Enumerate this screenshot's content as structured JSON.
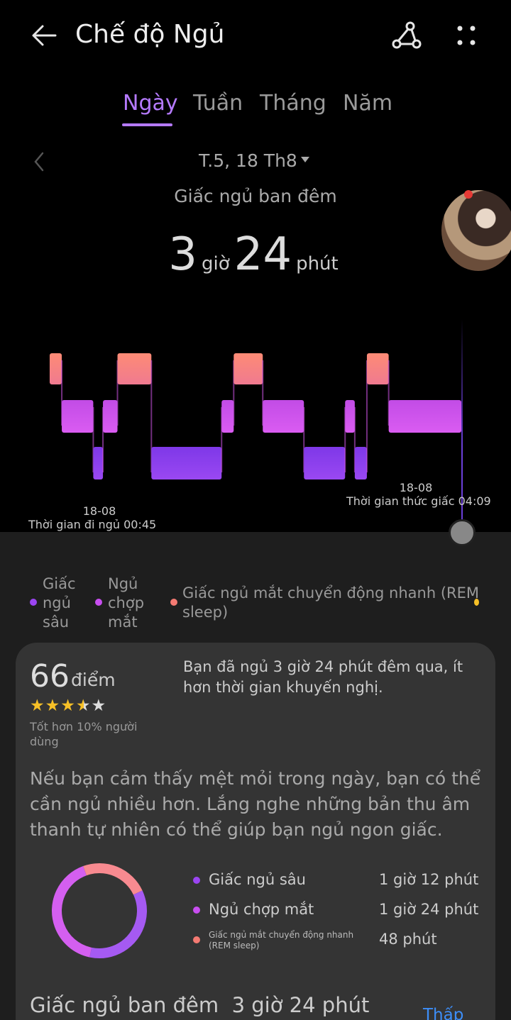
{
  "header": {
    "title": "Chế độ Ngủ"
  },
  "tabs": [
    {
      "label": "Ngày",
      "active": true
    },
    {
      "label": "Tuần",
      "active": false
    },
    {
      "label": "Tháng",
      "active": false
    },
    {
      "label": "Năm",
      "active": false
    }
  ],
  "date_selector": {
    "date": "T.5, 18 Th8"
  },
  "summary": {
    "subtitle": "Giấc ngủ ban đêm",
    "hours": "3",
    "hours_unit": "giờ",
    "minutes": "24",
    "minutes_unit": "phút"
  },
  "sleep_chart": {
    "stages": [
      "rem",
      "light",
      "deep"
    ],
    "segments": [
      {
        "stage": "rem",
        "start": 0.0,
        "end": 0.05
      },
      {
        "stage": "light",
        "start": 0.05,
        "end": 0.18
      },
      {
        "stage": "deep",
        "start": 0.18,
        "end": 0.22
      },
      {
        "stage": "light",
        "start": 0.22,
        "end": 0.28
      },
      {
        "stage": "rem",
        "start": 0.28,
        "end": 0.42
      },
      {
        "stage": "deep",
        "start": 0.42,
        "end": 0.71
      },
      {
        "stage": "light",
        "start": 0.71,
        "end": 0.76
      },
      {
        "stage": "rem",
        "start": 0.76,
        "end": 0.88
      },
      {
        "stage": "light",
        "start": 0.88,
        "end": 1.05
      },
      {
        "stage": "deep",
        "start": 1.05,
        "end": 1.22
      },
      {
        "stage": "light",
        "start": 1.22,
        "end": 1.26
      },
      {
        "stage": "deep",
        "start": 1.26,
        "end": 1.31
      },
      {
        "stage": "rem",
        "start": 1.31,
        "end": 1.4
      },
      {
        "stage": "light",
        "start": 1.4,
        "end": 1.7
      }
    ],
    "total_span": 1.7,
    "sleep_time_date": "18-08",
    "sleep_time_label": "Thời gian đi ngủ 00:45",
    "wake_time_date": "18-08",
    "wake_time_label": "Thời gian thức giấc 04:09",
    "colors": {
      "rem": "#f98a7c",
      "light": "#c84ef0",
      "deep": "#8c3cf0"
    }
  },
  "legend": [
    {
      "label": "Giấc ngủ sâu",
      "color": "#9b45f2"
    },
    {
      "label": "Ngủ chợp mắt",
      "color": "#c84ef0"
    },
    {
      "label": "Giấc ngủ mắt chuyển động nhanh (REM sleep)",
      "color": "#f47a72"
    }
  ],
  "score_card": {
    "score": "66",
    "score_unit": "điểm",
    "stars_full": 3,
    "stars_half": 1,
    "stars_total": 5,
    "comparison": "Tốt hơn 10% người dùng",
    "summary_text": "Bạn đã ngủ 3 giờ 24 phút đêm qua, ít hơn thời gian khuyến nghị.",
    "advice_text": "Nếu bạn cảm thấy mệt mỏi trong ngày, bạn có thể cần ngủ nhiều hơn. Lắng nghe những bản thu âm thanh tự nhiên có thể giúp bạn ngủ ngon giấc."
  },
  "breakdown": {
    "rows": [
      {
        "label": "Giấc ngủ sâu",
        "value": "1 giờ 12 phút",
        "color": "#9b45f2",
        "minutes": 72
      },
      {
        "label": "Ngủ chợp mắt",
        "value": "1 giờ 24 phút",
        "color": "#c84ef0",
        "minutes": 84
      },
      {
        "label": "Giấc ngủ mắt chuyển động nhanh (REM sleep)",
        "value": "48 phút",
        "color": "#f47a72",
        "minutes": 48
      }
    ]
  },
  "night_section": {
    "title": "Giấc ngủ ban đêm",
    "value": "3 giờ 24 phút",
    "link": "Thấp"
  }
}
